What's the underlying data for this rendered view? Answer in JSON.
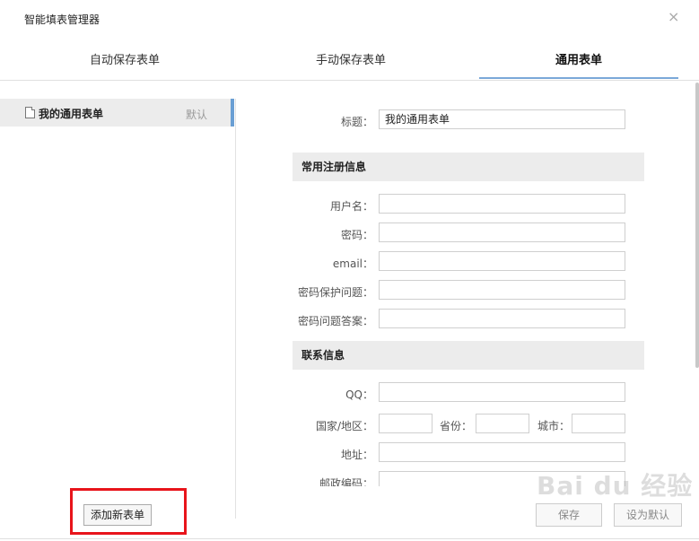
{
  "window": {
    "title": "智能填表管理器",
    "close_symbol": "×"
  },
  "tabs": [
    {
      "label": "自动保存表单",
      "active": false
    },
    {
      "label": "手动保存表单",
      "active": false
    },
    {
      "label": "通用表单",
      "active": true
    }
  ],
  "left": {
    "item": {
      "name": "我的通用表单",
      "badge": "默认"
    },
    "add_button": "添加新表单"
  },
  "form": {
    "title_label": "标题：",
    "title_value": "我的通用表单",
    "section1": "常用注册信息",
    "username_label": "用户名：",
    "password_label": "密码：",
    "email_label": "email：",
    "security_q_label": "密码保护问题：",
    "security_a_label": "密码问题答案：",
    "section2": "联系信息",
    "qq_label": "QQ：",
    "country_label": "国家/地区：",
    "province_label": "省份：",
    "city_label": "城市：",
    "address_label": "地址：",
    "zip_label": "邮政编码："
  },
  "actions": {
    "save": "保存",
    "set_default": "设为默认"
  },
  "watermark": "Bai du 经验",
  "colors": {
    "tab_active_underline": "#7aa8d8",
    "selection_bar": "#6a9fd4",
    "highlight_box": "#e8141b"
  }
}
